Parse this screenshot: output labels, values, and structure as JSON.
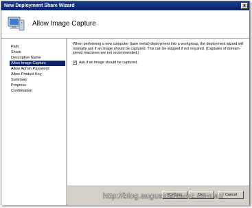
{
  "window": {
    "title": "New Deployment Share Wizard",
    "close_glyph": "x"
  },
  "header": {
    "title": "Allow Image Capture",
    "icon": "computer-wizard-icon"
  },
  "nav": {
    "items": [
      {
        "label": "Path"
      },
      {
        "label": "Share"
      },
      {
        "label": "Descriptive Name"
      },
      {
        "label": "Allow Image Capture",
        "active": true
      },
      {
        "label": "Allow Admin Password"
      },
      {
        "label": "Allow Product Key"
      },
      {
        "label": "Summary"
      },
      {
        "label": "Progress"
      },
      {
        "label": "Confirmation"
      }
    ]
  },
  "content": {
    "description": "When performing a new computer (bare metal) deployment into a workgroup, the deployment wizard will normally ask if an image should be captured.  This can be skipped if not required.  (Captures of domain-joined machines are not recommended.)",
    "checkbox_label": "Ask if an image should be captured.",
    "checkbox_checked": true,
    "check_glyph": "✓"
  },
  "buttons": {
    "previous": "Previous",
    "next": "Next",
    "cancel": "Cancel"
  },
  "watermark": "http://blog.augustoalvarez.com.ar/",
  "colors": {
    "title_bar": "#0a246a",
    "selection": "#0a246a",
    "dialog_face": "#d4d0c8"
  }
}
